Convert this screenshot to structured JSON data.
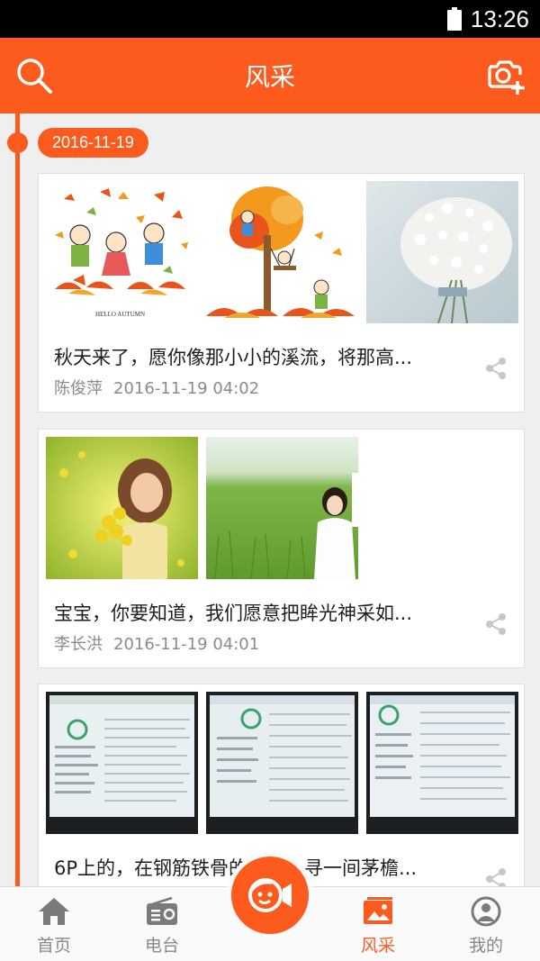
{
  "status_bar": {
    "time": "13:26"
  },
  "header": {
    "title": "风采"
  },
  "feed": {
    "date": "2016-11-19",
    "posts": [
      {
        "text": "秋天来了，愿你像那小小的溪流，将那高...",
        "author": "陈俊萍",
        "time": "2016-11-19 04:02"
      },
      {
        "text": "宝宝，你要知道，我们愿意把眸光神采如...",
        "author": "李长洪",
        "time": "2016-11-19 04:01"
      },
      {
        "text": "6P上的，在钢筋铁骨的城里，寻一间茅檐...",
        "author": "",
        "time": ""
      }
    ]
  },
  "bottom_nav": {
    "items": [
      {
        "label": "首页",
        "icon": "home-icon"
      },
      {
        "label": "电台",
        "icon": "radio-icon"
      },
      {
        "label": "风采",
        "icon": "gallery-icon"
      },
      {
        "label": "我的",
        "icon": "profile-icon"
      }
    ],
    "active": "风采"
  },
  "colors": {
    "accent": "#fd5a1e",
    "background": "#efefef",
    "text": "#1e1e1e",
    "muted": "#8a8a8a"
  }
}
